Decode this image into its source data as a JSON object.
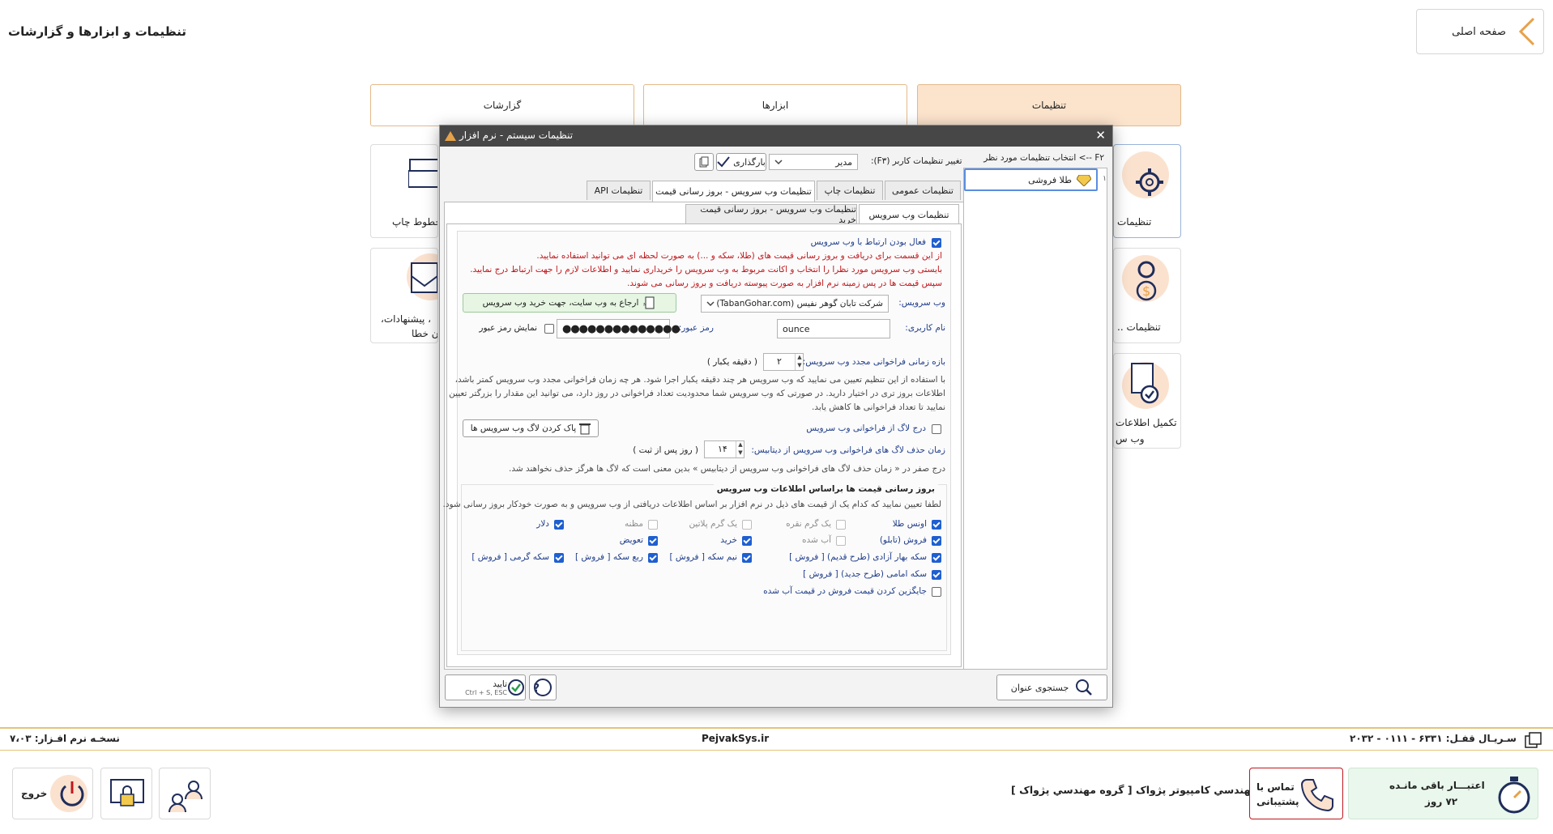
{
  "header": {
    "home_label": "صفحه اصلی",
    "page_title": "تنظیمات و ابزارها و گزارشات"
  },
  "top_tabs": [
    {
      "label": "تنظیمات",
      "active": true
    },
    {
      "label": "ابزارها",
      "active": false
    },
    {
      "label": "گزارشات",
      "active": false
    }
  ],
  "background_tiles": {
    "settings": "تنظیمات",
    "settings_2": "تنظیمات ..",
    "complete_info_1": "تکمیل اطلاعات",
    "complete_info_2": "وب س",
    "print_lines": "خطوط چاپ",
    "suggestions_1": "، پیشنهادات،",
    "suggestions_2": "ن خطا"
  },
  "dialog": {
    "title": "تنظیمات سیستم - نرم افزار",
    "left_panel": {
      "select_label": "F۲ --> انتخاب تنظیمات مورد نظر",
      "row_number": "۱",
      "selected_item": "طلا فروشی",
      "search_button": "جستجوی عنوان"
    },
    "user_settings": {
      "label": "تغییر تنظیمات کاربر (F۳):",
      "value": "مدیر",
      "load_button": "بارگذاری"
    },
    "tabs": [
      {
        "label": "تنظیمات عمومی",
        "active": false
      },
      {
        "label": "تنظیمات چاپ",
        "active": false
      },
      {
        "label": "تنظیمات وب سرویس - بروز رسانی قیمت",
        "active": true
      },
      {
        "label": "تنظیمات API",
        "active": false
      }
    ],
    "sub_tabs": [
      {
        "label": "تنظیمات وب سرویس",
        "active": true
      },
      {
        "label": "تنظیمات وب سرویس - بروز رسانی قیمت خرید",
        "active": false
      }
    ],
    "webservice": {
      "enable_label": "فعال بودن ارتباط با وب سرویس",
      "info_lines": [
        "از این قسمت برای دریافت و بروز رسانی قیمت های (طلا، سکه و ...) به صورت لحظه ای می توانید استفاده نمایید.",
        "بایستی وب سرویس مورد نظرا را انتخاب و اکانت مربوط به وب سرویس را خریداری نمایید و اطلاعات لازم را جهت ارتباط درج نمایید.",
        "سپس قیمت ها در پس زمینه نرم افزار به صورت پیوسته دریافت و بروز رسانی می شوند."
      ],
      "service_label": "وب سرویس:",
      "service_value": "شرکت تابان گوهر نفیس (TabanGohar.com)",
      "website_button": "ارجاع به وب سایت، جهت خرید وب سرویس",
      "username_label": "نام کاربری:",
      "username_value": "ounce",
      "password_label": "رمز عبور:",
      "password_value": "●●●●●●●●●●●●●●",
      "show_password_label": "نمایش رمز عبور",
      "interval_label": "بازه زمانی فراخوانی مجدد وب سرویس:",
      "interval_value": "۲",
      "interval_unit": "( دقیقه یکبار )",
      "interval_help": [
        "با استفاده از این تنظیم تعیین می نمایید که وب سرویس هر چند دقیقه یکبار اجرا شود. هر چه زمان فراخوانی مجدد وب سرویس کمتر باشد،",
        "اطلاعات بروز تری در اختیار دارید. در صورتی که وب سرویس شما محدودیت تعداد فراخوانی در روز دارد، می توانید این مقدار را بزرگتر تعیین",
        "نمایید تا تعداد فراخوانی ها کاهش یابد."
      ],
      "log_label": "درج لاگ از فراخوانی وب سرویس",
      "clear_log_button": "پاک کردن لاگ وب سرویس ها",
      "log_delete_label": "زمان حذف لاگ های فراخوانی وب سرویس از دیتابیس:",
      "log_delete_value": "۱۴",
      "log_delete_unit": "( روز پس از ثبت )",
      "log_delete_help": "درج صفر در « زمان حذف لاگ های فراخوانی وب سرویس از دیتابیس » بدین معنی است که لاگ ها هرگز حذف نخواهند شد."
    },
    "price_update": {
      "group_title": "بروز رسانی قیمت ها براساس اطلاعات وب سرویس",
      "description": "لطفا تعیین نمایید که کدام یک از قیمت های ذیل در نرم افزار بر اساس اطلاعات دریافتی از وب سرویس و به صورت خودکار بروز رسانی شود.",
      "options": [
        {
          "label": "اونس طلا",
          "checked": true,
          "enabled": true
        },
        {
          "label": "یک گرم نقره",
          "checked": false,
          "enabled": false
        },
        {
          "label": "یک گرم پلاتین",
          "checked": false,
          "enabled": false
        },
        {
          "label": "مظنه",
          "checked": false,
          "enabled": false
        },
        {
          "label": "دلار",
          "checked": true,
          "enabled": true
        },
        {
          "label": "فروش (تابلو)",
          "checked": true,
          "enabled": true
        },
        {
          "label": "آب شده",
          "checked": false,
          "enabled": false
        },
        {
          "label": "خرید",
          "checked": true,
          "enabled": true
        },
        {
          "label": "تعویض",
          "checked": true,
          "enabled": true
        },
        {
          "label": "سکه بهار آزادی (طرح قدیم) [ فروش ]",
          "checked": true,
          "enabled": true
        },
        {
          "label": "نیم سکه [ فروش ]",
          "checked": true,
          "enabled": true
        },
        {
          "label": "ربع سکه [ فروش ]",
          "checked": true,
          "enabled": true
        },
        {
          "label": "سکه گرمی [ فروش ]",
          "checked": true,
          "enabled": true
        },
        {
          "label": "سکه امامی (طرح جدید) [ فروش ]",
          "checked": true,
          "enabled": true
        }
      ],
      "replace_label": "جایگزین کردن قیمت فروش در قیمت آب شده"
    },
    "confirm_button": "تایید",
    "confirm_shortcut": "Ctrl + S, ESC"
  },
  "footer": {
    "version": "نسخـه نرم افـزار: ۷،۰۳",
    "website": "PejvakSys.ir",
    "serial": "سـریـال قفـل: ۶۳۳۱ - ۰۱۱۱ - ۲۰۳۲"
  },
  "bottom_bar": {
    "exit_label": "خروج",
    "company": "شرکت مهندسي کامپيوتر پژواک [ گروه مهندسي پژواک ]",
    "support_line1": "تماس با",
    "support_line2": "پشتیبانی",
    "credit_line1": "اعتبـــار باقی مانـده",
    "credit_line2": "۷۲ روز"
  },
  "colors": {
    "accent_orange": "#e6a24a",
    "tab_active_bg": "#fbe3cc",
    "credit_bg": "#e9f7ec",
    "support_border": "#c0171c",
    "checkbox_blue": "#1e5fd1",
    "dialog_titlebar": "#474747"
  }
}
